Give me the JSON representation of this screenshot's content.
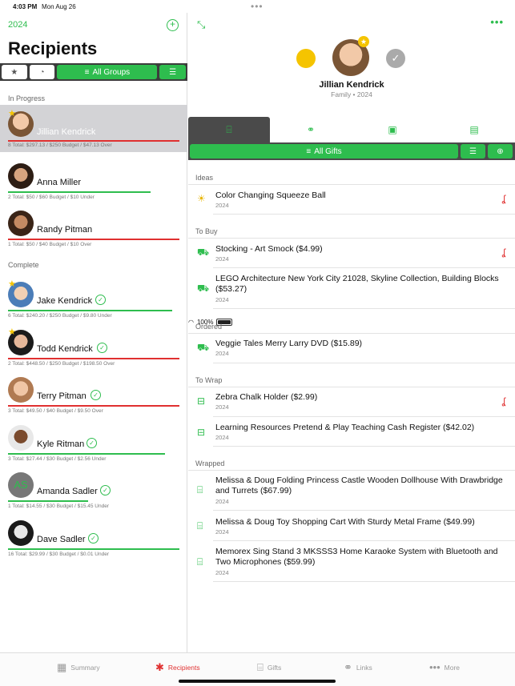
{
  "status": {
    "time": "4:03 PM",
    "date": "Mon Aug 26",
    "battery": "100%"
  },
  "left": {
    "year": "2024",
    "title": "Recipients",
    "groups_label": "All Groups",
    "sections": {
      "in_progress": "In Progress",
      "complete": "Complete"
    },
    "people": [
      {
        "name": "Jillian Kendrick",
        "info": "8 Total: $297.13 / $250 Budget / $47.13 Over"
      },
      {
        "name": "Anna Miller",
        "info": "2 Total: $50 / $60 Budget / $10 Under"
      },
      {
        "name": "Randy Pitman",
        "info": "1 Total: $50 / $40 Budget / $10 Over"
      },
      {
        "name": "Jake Kendrick",
        "info": "6 Total: $240.20 / $250 Budget / $9.80 Under"
      },
      {
        "name": "Todd Kendrick",
        "info": "2 Total: $448.50 / $250 Budget / $198.50 Over"
      },
      {
        "name": "Terry Pitman",
        "info": "3 Total: $49.50 / $40 Budget / $9.50 Over"
      },
      {
        "name": "Kyle Ritman",
        "info": "3 Total: $27.44 / $30 Budget / $2.56 Under"
      },
      {
        "name": "Amanda Sadler",
        "initials": "AS",
        "info": "1 Total: $14.55 / $30 Budget / $15.45 Under"
      },
      {
        "name": "Dave Sadler",
        "info": "16 Total: $29.99 / $30 Budget / $0.01 Under"
      }
    ]
  },
  "right": {
    "name": "Jillian Kendrick",
    "sub": "Family • 2024",
    "gifts_label": "All Gifts",
    "sections": {
      "ideas": "Ideas",
      "to_buy": "To Buy",
      "ordered": "Ordered",
      "to_wrap": "To Wrap",
      "wrapped": "Wrapped"
    },
    "gifts": [
      {
        "title": "Color Changing Squeeze Ball",
        "year": "2024"
      },
      {
        "title": "Stocking - Art Smock ($4.99)",
        "year": "2024"
      },
      {
        "title": "LEGO Architecture New York City 21028, Skyline Collection, Building Blocks ($53.27)",
        "year": "2024"
      },
      {
        "title": "Veggie Tales Merry Larry DVD ($15.89)",
        "year": "2024"
      },
      {
        "title": "Zebra Chalk Holder ($2.99)",
        "year": "2024"
      },
      {
        "title": "Learning Resources Pretend & Play Teaching Cash Register ($42.02)",
        "year": "2024"
      },
      {
        "title": "Melissa & Doug Folding Princess Castle Wooden Dollhouse With Drawbridge and Turrets ($67.99)",
        "year": "2024"
      },
      {
        "title": "Melissa & Doug Toy Shopping Cart With Sturdy Metal Frame ($49.99)",
        "year": "2024"
      },
      {
        "title": "Memorex Sing Stand 3 MKSSS3 Home Karaoke System with Bluetooth and Two Microphones ($59.99)",
        "year": "2024"
      }
    ]
  },
  "tabbar": {
    "summary": "Summary",
    "recipients": "Recipients",
    "gifts": "Gifts",
    "links": "Links",
    "more": "More"
  },
  "colors": {
    "accent": "#2ebd4e",
    "over": "#e03030",
    "star": "#f5c400"
  }
}
